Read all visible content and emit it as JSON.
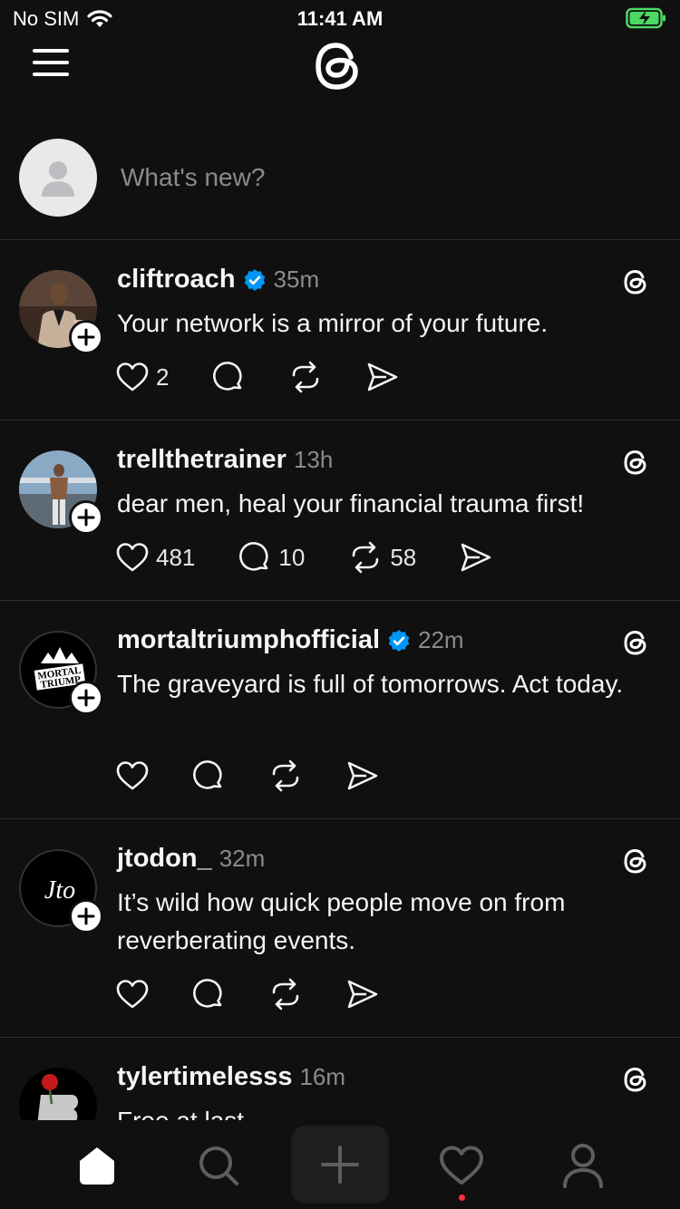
{
  "status_bar": {
    "carrier": "No SIM",
    "time": "11:41 AM"
  },
  "header": {
    "logo": "threads-logo"
  },
  "composer": {
    "placeholder": "What's new?"
  },
  "posts": [
    {
      "username": "cliftroach",
      "verified": true,
      "time": "35m",
      "text": "Your network is a mirror of your future.",
      "likes": "2",
      "replies": "",
      "reposts": ""
    },
    {
      "username": "trellthetrainer",
      "verified": false,
      "time": "13h",
      "text": "dear men, heal your financial trauma first!",
      "likes": "481",
      "replies": "10",
      "reposts": "58"
    },
    {
      "username": "mortaltriumphofficial",
      "verified": true,
      "time": "22m",
      "text": "The graveyard is full of tomorrows. Act today.",
      "likes": "",
      "replies": "",
      "reposts": "",
      "avatar_text": "MORTAL TRIUMP"
    },
    {
      "username": "jtodon_",
      "verified": false,
      "time": "32m",
      "text": "It’s wild how quick people move on from reverberating events.",
      "likes": "",
      "replies": "",
      "reposts": "",
      "avatar_text": "Jto"
    },
    {
      "username": "tylertimelesss",
      "verified": false,
      "time": "16m",
      "text": "Free at last",
      "likes": "",
      "replies": "",
      "reposts": ""
    }
  ],
  "tab_bar": {
    "items": [
      "home-icon",
      "search-icon",
      "create-icon",
      "activity-icon",
      "profile-icon"
    ]
  },
  "colors": {
    "background": "#101010",
    "verified": "#0095f6",
    "notification_dot": "#ff3040",
    "secondary_text": "#8b8b8e"
  }
}
